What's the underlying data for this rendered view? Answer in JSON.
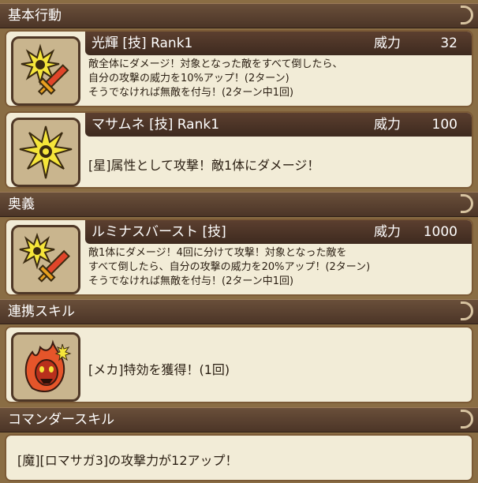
{
  "sections": {
    "basic": "基本行動",
    "ougi": "奥義",
    "renkei": "連携スキル",
    "commander": "コマンダースキル"
  },
  "power_label": "威力",
  "skills": [
    {
      "name": "光輝 [技]  Rank1",
      "power": "32",
      "icon": "star-burst-sword-icon",
      "desc": [
        "敵全体にダメージ！対象となった敵をすべて倒したら、",
        "自分の攻撃の威力を10%アップ！(2ターン)",
        "そうでなければ無敵を付与！(2ターン中1回)"
      ]
    },
    {
      "name": "マサムネ [技]  Rank1",
      "power": "100",
      "icon": "star-burst-icon",
      "desc": [
        "[星]属性として攻撃！敵1体にダメージ！"
      ]
    },
    {
      "name": "ルミナスバースト [技]",
      "power": "1000",
      "icon": "star-burst-sword-icon",
      "desc": [
        "敵1体にダメージ！4回に分けて攻撃！対象となった敵を",
        "すべて倒したら、自分の攻撃の威力を20%アップ！(2ターン)",
        "そうでなければ無敵を付与！(2ターン中1回)"
      ]
    }
  ],
  "renkei_skill": {
    "icon": "flame-mask-icon",
    "text": "[メカ]特効を獲得！(1回)"
  },
  "commander_skill": {
    "text": "[魔][ロマサガ3]の攻撃力が12アップ！"
  }
}
